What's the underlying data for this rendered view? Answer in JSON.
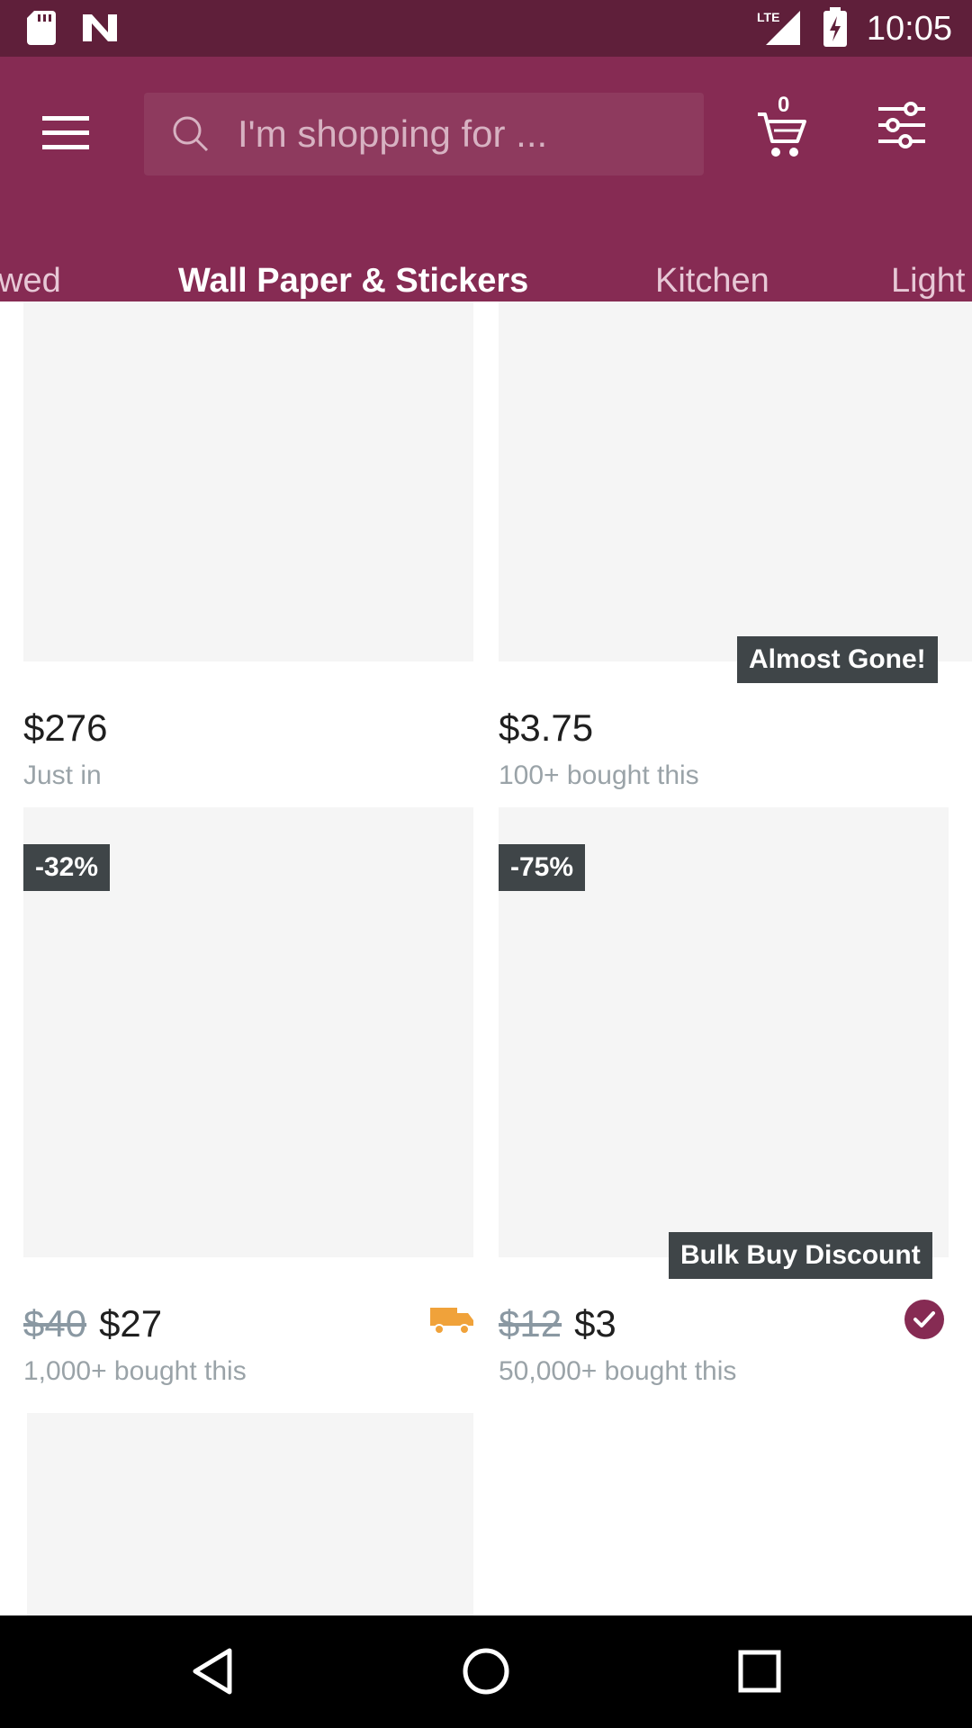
{
  "status_bar": {
    "time": "10:05",
    "network": "LTE",
    "icons": [
      "sd-card-icon",
      "n-notification-icon",
      "lte-signal-icon",
      "battery-charging-icon"
    ]
  },
  "app_bar": {
    "search_placeholder": "I'm shopping for ...",
    "cart_count": "0",
    "brand_color": "#862b53",
    "status_color": "#5f1f3a"
  },
  "tabs": [
    {
      "label": "wed",
      "active": false
    },
    {
      "label": "Wall Paper & Stickers",
      "active": true
    },
    {
      "label": "Kitchen",
      "active": false
    },
    {
      "label": "Light",
      "active": false
    }
  ],
  "products": [
    {
      "price": "$276",
      "meta": "Just in"
    },
    {
      "price": "$3.75",
      "meta": "100+ bought this",
      "badge": "Almost Gone!"
    },
    {
      "discount": "-32%",
      "old_price": "$40",
      "price": "$27",
      "meta": "1,000+ bought this",
      "icon": "shipping-truck-icon"
    },
    {
      "discount": "-75%",
      "old_price": "$12",
      "price": "$3",
      "meta": "50,000+ bought this",
      "badge": "Bulk Buy Discount",
      "icon": "verified-check-icon"
    }
  ],
  "nav_bar": {
    "buttons": [
      "back-icon",
      "home-icon",
      "recents-icon"
    ]
  }
}
